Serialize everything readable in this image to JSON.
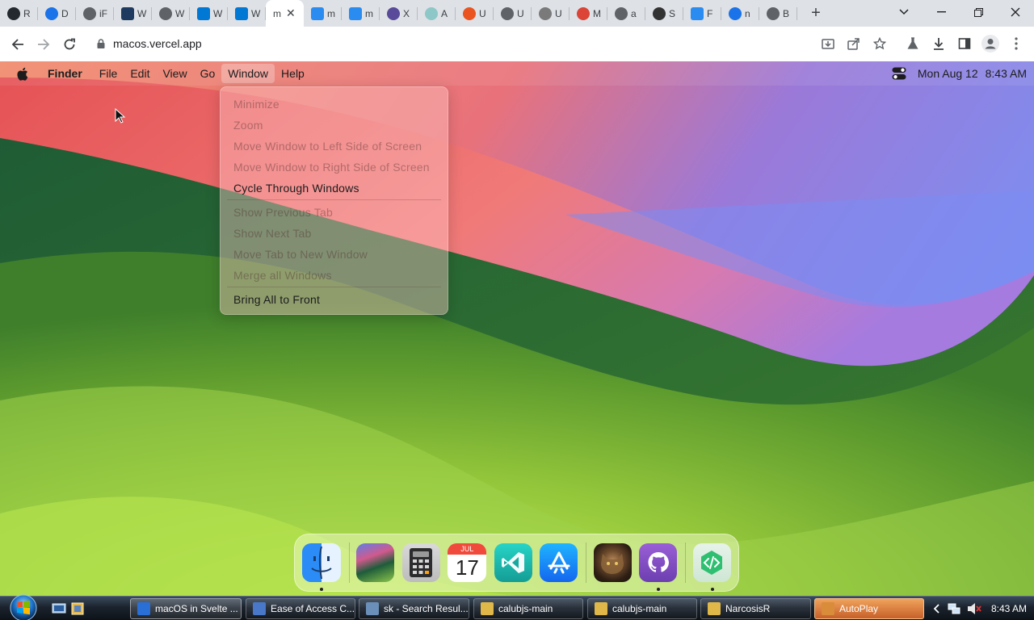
{
  "browser": {
    "tabs": [
      {
        "label": "R",
        "icon": "github-icon",
        "color": "#24292f"
      },
      {
        "label": "D",
        "icon": "download-icon",
        "color": "#1a73e8"
      },
      {
        "label": "iF",
        "icon": "globe-icon",
        "color": "#5f6368"
      },
      {
        "label": "W",
        "icon": "app-icon",
        "color": "#1f3a5f"
      },
      {
        "label": "W",
        "icon": "globe-icon",
        "color": "#5f6368"
      },
      {
        "label": "W",
        "icon": "windows-icon",
        "color": "#0078d4"
      },
      {
        "label": "W",
        "icon": "windows-icon",
        "color": "#0078d4"
      },
      {
        "label": "m",
        "icon": "",
        "color": "#ffffff",
        "active": true
      },
      {
        "label": "m",
        "icon": "finder-icon",
        "color": "#2a8cf0"
      },
      {
        "label": "m",
        "icon": "finder-icon",
        "color": "#2a8cf0"
      },
      {
        "label": "X",
        "icon": "cat-icon",
        "color": "#5a4a9a"
      },
      {
        "label": "A",
        "icon": "person-icon",
        "color": "#8ec7c7"
      },
      {
        "label": "U",
        "icon": "ubuntu-icon",
        "color": "#e95420"
      },
      {
        "label": "U",
        "icon": "globe-icon",
        "color": "#5f6368"
      },
      {
        "label": "U",
        "icon": "circle-icon",
        "color": "#7a7a7a"
      },
      {
        "label": "M",
        "icon": "chrome-icon",
        "color": "#db4437"
      },
      {
        "label": "a",
        "icon": "globe-icon",
        "color": "#5f6368"
      },
      {
        "label": "S",
        "icon": "bird-icon",
        "color": "#333333"
      },
      {
        "label": "F",
        "icon": "finder-icon",
        "color": "#2a8cf0"
      },
      {
        "label": "n",
        "icon": "search-icon",
        "color": "#1a73e8"
      },
      {
        "label": "B",
        "icon": "globe-icon",
        "color": "#5f6368"
      }
    ],
    "url": "macos.vercel.app"
  },
  "menubar": {
    "app_name": "Finder",
    "items": [
      "File",
      "Edit",
      "View",
      "Go",
      "Window",
      "Help"
    ],
    "active_item": "Window",
    "date": "Mon Aug 12",
    "time": "8:43 AM"
  },
  "window_menu": {
    "items": [
      {
        "label": "Minimize",
        "enabled": false
      },
      {
        "label": "Zoom",
        "enabled": false
      },
      {
        "label": "Move Window to Left Side of Screen",
        "enabled": false
      },
      {
        "label": "Move Window to Right Side of Screen",
        "enabled": false
      },
      {
        "label": "Cycle Through Windows",
        "enabled": true
      },
      {
        "label": "Show Previous Tab",
        "enabled": false
      },
      {
        "label": "Show Next Tab",
        "enabled": false
      },
      {
        "label": "Move Tab to New Window",
        "enabled": false
      },
      {
        "label": "Merge all Windows",
        "enabled": false
      },
      {
        "label": "Bring All to Front",
        "enabled": true
      }
    ]
  },
  "dock": {
    "apps": [
      {
        "name": "finder-icon",
        "running": true
      },
      {
        "name": "wallpapers-icon",
        "running": false
      },
      {
        "name": "calculator-icon",
        "running": false
      },
      {
        "name": "calendar-icon",
        "running": false,
        "month": "JUL",
        "day": "17"
      },
      {
        "name": "vscode-icon",
        "running": false
      },
      {
        "name": "app-store-icon",
        "running": false
      },
      {
        "name": "photo-cat-icon",
        "running": false
      },
      {
        "name": "github-icon",
        "running": true
      },
      {
        "name": "dev-tools-icon",
        "running": true
      }
    ]
  },
  "taskbar": {
    "windows": [
      {
        "label": "macOS in Svelte ...",
        "active": true
      },
      {
        "label": "Ease of Access C...",
        "active": false
      },
      {
        "label": "sk - Search Resul...",
        "active": false
      },
      {
        "label": "calubjs-main",
        "active": false
      },
      {
        "label": "calubjs-main",
        "active": false
      },
      {
        "label": "NarcosisR",
        "active": false
      },
      {
        "label": "AutoPlay",
        "active": false
      }
    ],
    "time": "8:43 AM"
  }
}
